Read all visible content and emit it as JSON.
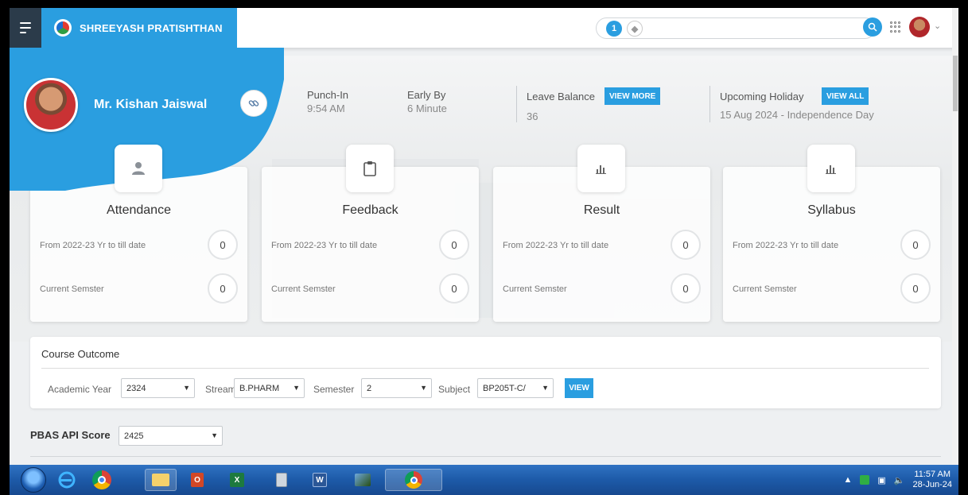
{
  "brand": {
    "name": "SHREEYASH PRATISHTHAN"
  },
  "profile": {
    "name": "Mr. Kishan Jaiswal"
  },
  "stats": {
    "punch_in_label": "Punch-In",
    "punch_in_value": "9:54 AM",
    "early_label": "Early By",
    "early_value": "6 Minute",
    "leave_label": "Leave Balance",
    "leave_button": "VIEW MORE",
    "leave_value": "36",
    "holiday_label": "Upcoming Holiday",
    "holiday_button": "VIEW ALL",
    "holiday_value": "15 Aug 2024 - Independence Day"
  },
  "cards": [
    {
      "title": "Attendance",
      "row1_label": "From 2022-23 Yr to till date",
      "row1_value": "0",
      "row2_label": "Current Semster",
      "row2_value": "0",
      "icon": "user-icon"
    },
    {
      "title": "Feedback",
      "row1_label": "From 2022-23 Yr to till date",
      "row1_value": "0",
      "row2_label": "Current Semster",
      "row2_value": "0",
      "icon": "clipboard-icon"
    },
    {
      "title": "Result",
      "row1_label": "From 2022-23 Yr to till date",
      "row1_value": "0",
      "row2_label": "Current Semster",
      "row2_value": "0",
      "icon": "bar-chart-icon"
    },
    {
      "title": "Syllabus",
      "row1_label": "From 2022-23 Yr to till date",
      "row1_value": "0",
      "row2_label": "Current Semster",
      "row2_value": "0",
      "icon": "bar-chart-icon"
    }
  ],
  "course_outcome": {
    "title": "Course Outcome",
    "academic_year_label": "Academic Year",
    "academic_year_value": "2324",
    "stream_label": "Stream",
    "stream_value": "B.PHARM",
    "semester_label": "Semester",
    "semester_value": "2",
    "subject_label": "Subject",
    "subject_value": "BP205T-C/",
    "view_button": "VIEW"
  },
  "pbas": {
    "label": "PBAS API Score",
    "value": "2425"
  },
  "taskbar": {
    "time": "11:57 AM",
    "date": "28-Jun-24"
  },
  "colors": {
    "accent": "#2a9ee0",
    "menu_bg": "#2b3b4a",
    "taskbar": "#1d5aa8"
  }
}
